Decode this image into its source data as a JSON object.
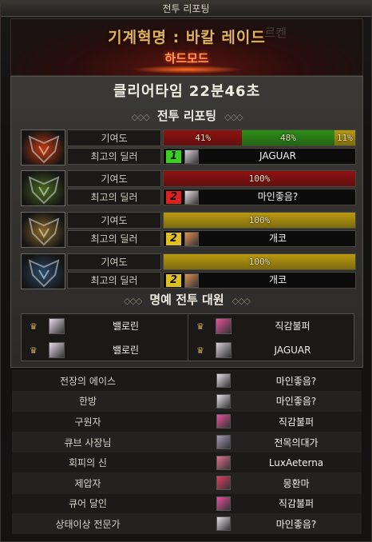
{
  "window": {
    "title": "전투 리포팅"
  },
  "banner": {
    "raid_title": "기계혁명 : 바칼 레이드",
    "mode": "하드모드",
    "ghost_text": "르켄"
  },
  "clear": {
    "text": "클리어타임  22분46초"
  },
  "report": {
    "section_title": "전투 리포팅",
    "contribution_label": "기여도",
    "top_dealer_label": "최고의 딜러",
    "bosses": [
      {
        "icon": "boss-flame-icon",
        "portrait_color": "#c23a10",
        "bars": [
          {
            "pct": 41,
            "label": "41%",
            "color": "#8e1212"
          },
          {
            "pct": 48,
            "label": "48%",
            "color": "#2e8e18"
          },
          {
            "pct": 11,
            "label": "11%",
            "color": "#b89a10"
          }
        ],
        "dealer": {
          "rank": "1",
          "rank_color": "#3ad020",
          "name": "JAGUAR",
          "avatar_color": "#d8d0d8"
        }
      },
      {
        "icon": "boss-green-icon",
        "portrait_color": "#4a6a20",
        "bars": [
          {
            "pct": 100,
            "label": "100%",
            "color": "#8e1212"
          }
        ],
        "dealer": {
          "rank": "2",
          "rank_color": "#e02020",
          "name": "마인좋음?",
          "avatar_color": "#e6e0e6"
        }
      },
      {
        "icon": "boss-gold-icon",
        "portrait_color": "#8a6a28",
        "bars": [
          {
            "pct": 100,
            "label": "100%",
            "color": "#b89a10"
          }
        ],
        "dealer": {
          "rank": "2",
          "rank_color": "#e0c020",
          "name": "개코",
          "avatar_color": "#e09050"
        }
      },
      {
        "icon": "boss-blue-icon",
        "portrait_color": "#2a4a6a",
        "bars": [
          {
            "pct": 100,
            "label": "100%",
            "color": "#b89a10"
          }
        ],
        "dealer": {
          "rank": "2",
          "rank_color": "#e0c020",
          "name": "개코",
          "avatar_color": "#e09050"
        }
      }
    ]
  },
  "honor": {
    "section_title": "명예 전투 대원",
    "members": [
      {
        "name": "밸로린",
        "avatar_color": "#e6d8e6"
      },
      {
        "name": "직감불퍼",
        "avatar_color": "#e850a0"
      },
      {
        "name": "밸로린",
        "avatar_color": "#e6d8e6"
      },
      {
        "name": "JAGUAR",
        "avatar_color": "#d8d0d8"
      }
    ]
  },
  "awards": [
    {
      "title": "전장의 에이스",
      "name": "마인좋음?",
      "avatar_color": "#e6e0e6"
    },
    {
      "title": "한방",
      "name": "마인좋음?",
      "avatar_color": "#e6e0e6"
    },
    {
      "title": "구원자",
      "name": "직감불퍼",
      "avatar_color": "#e850a0"
    },
    {
      "title": "큐브 사장님",
      "name": "전목의대가",
      "avatar_color": "#a898b8"
    },
    {
      "title": "회피의 신",
      "name": "LuxAeterna",
      "avatar_color": "#e87090"
    },
    {
      "title": "제압자",
      "name": "몽환마",
      "avatar_color": "#e04060"
    },
    {
      "title": "큐어 달인",
      "name": "직감불퍼",
      "avatar_color": "#e850a0"
    },
    {
      "title": "상태이상 전문가",
      "name": "마인좋음?",
      "avatar_color": "#e6e0e6"
    }
  ]
}
